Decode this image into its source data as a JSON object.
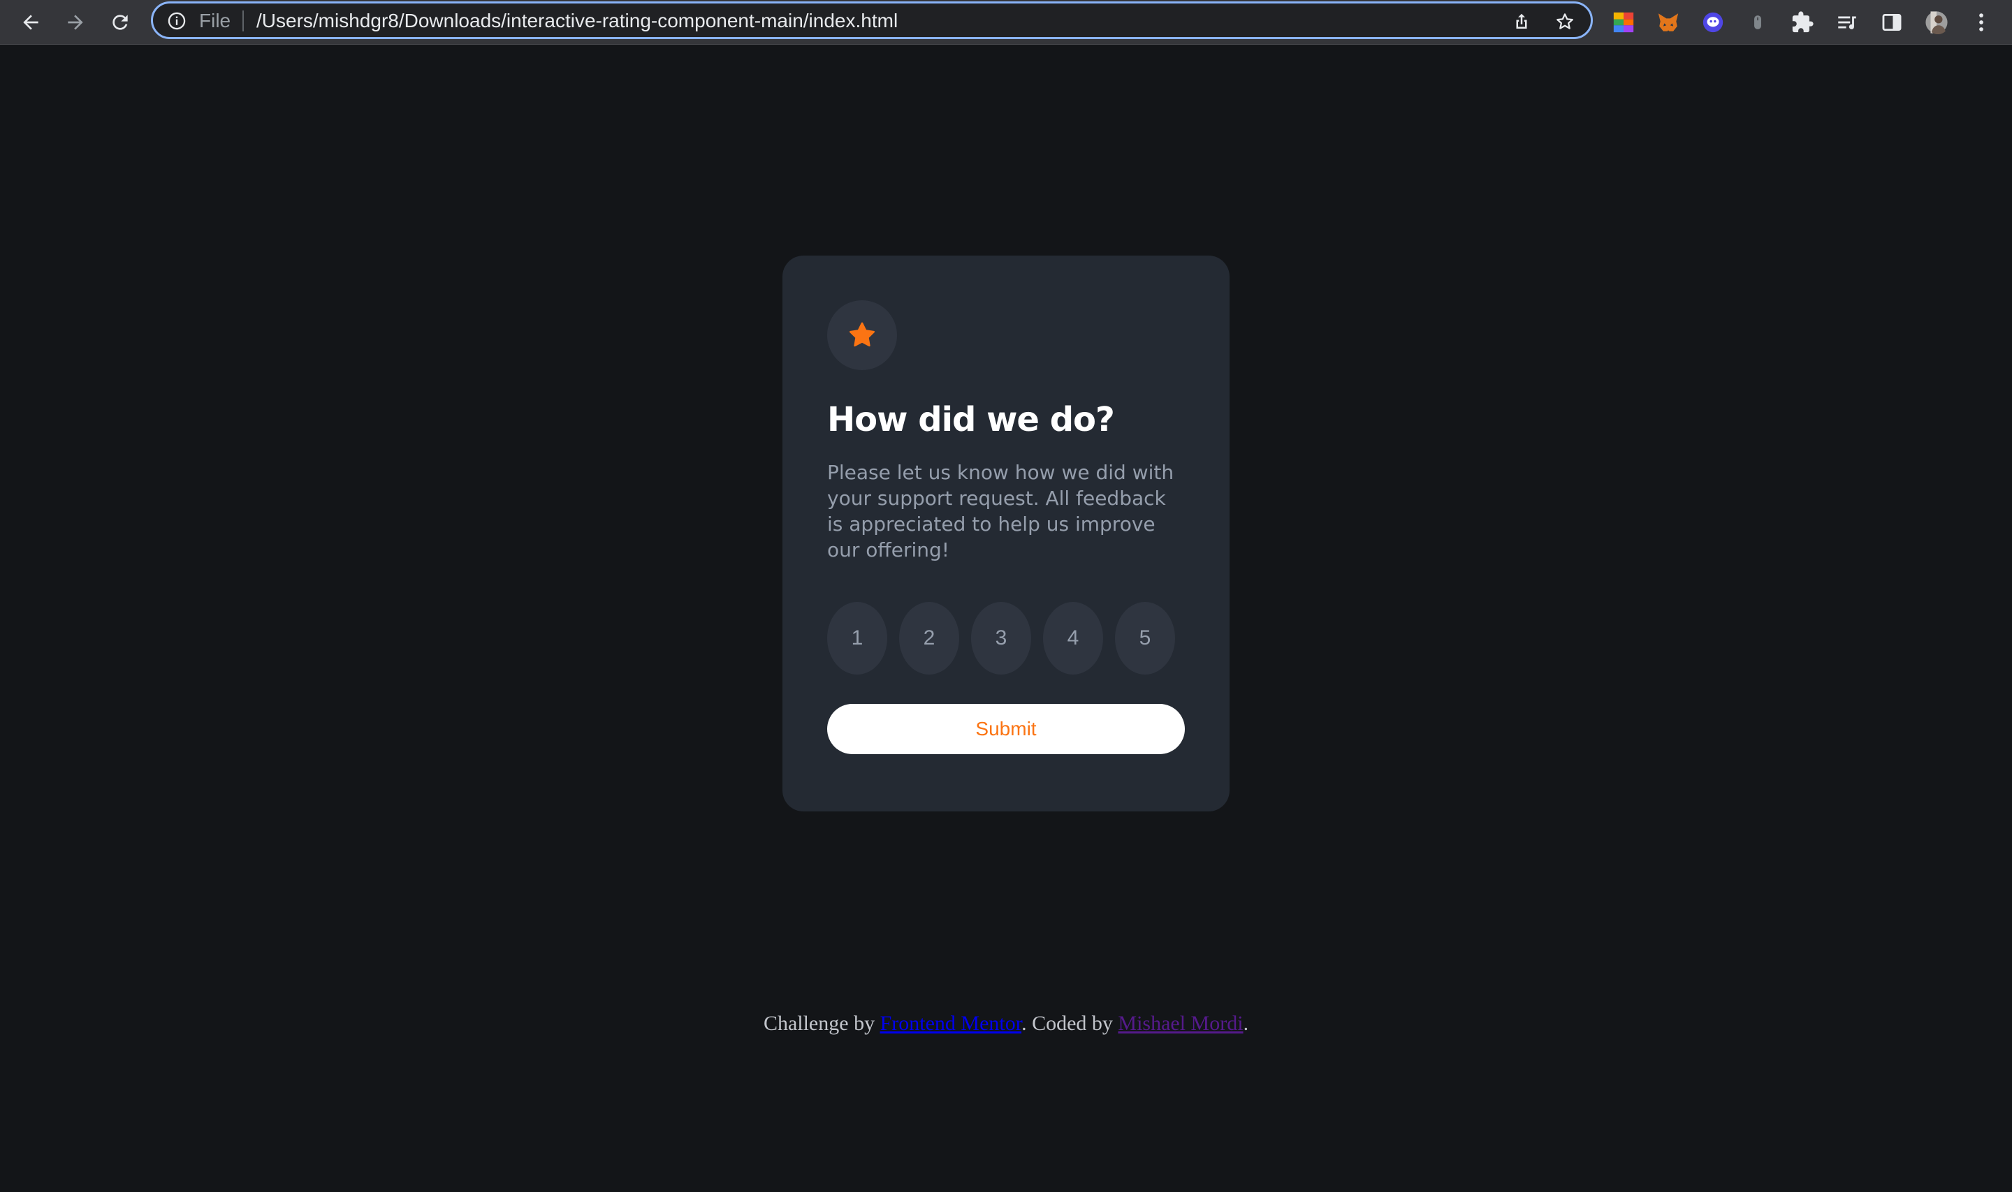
{
  "browser": {
    "file_label": "File",
    "url": "/Users/mishdgr8/Downloads/interactive-rating-component-main/index.html",
    "accent_color": "#8ab4f8",
    "icons": [
      "back-icon",
      "forward-icon",
      "reload-icon",
      "info-icon",
      "share-icon",
      "bookmark-star-icon",
      "rainbow-extension-icon",
      "metamask-fox-icon",
      "ghost-extension-icon",
      "mouse-extension-icon",
      "puzzle-extensions-icon",
      "reading-list-icon",
      "side-panel-icon",
      "profile-avatar",
      "menu-dots-icon"
    ]
  },
  "card": {
    "title": "How did we do?",
    "description": "Please let us know how we did with your support request. All feedback is appreciated to help us improve our offering!",
    "ratings": [
      "1",
      "2",
      "3",
      "4",
      "5"
    ],
    "submit_label": "Submit",
    "accent_color": "#fb7413",
    "background_color": "#242a33"
  },
  "attribution": {
    "prefix": "Challenge by ",
    "challenge_link": "Frontend Mentor",
    "middle": ". Coded by ",
    "author_link": "Mishael Mordi",
    "suffix": "."
  }
}
